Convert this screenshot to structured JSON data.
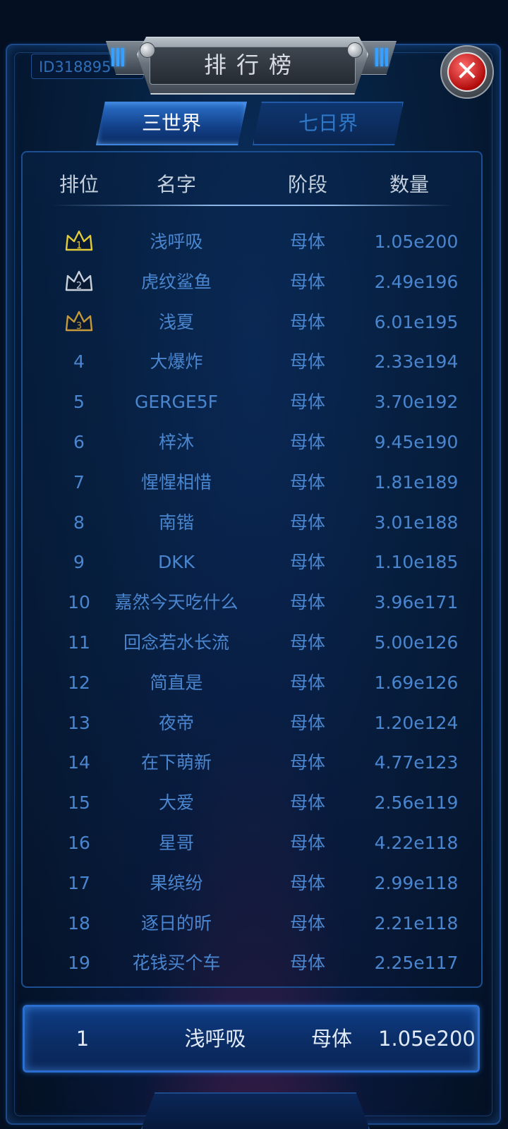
{
  "header": {
    "id_text": "ID318895",
    "title": "排行榜",
    "close_icon": "close-x-icon"
  },
  "tabs": [
    {
      "label": "三世界",
      "active": true
    },
    {
      "label": "七日界",
      "active": false
    }
  ],
  "columns": {
    "rank": "排位",
    "name": "名字",
    "stage": "阶段",
    "count": "数量"
  },
  "rows": [
    {
      "rank": "1",
      "name": "浅呼吸",
      "stage": "母体",
      "count": "1.05e200",
      "crown": "gold"
    },
    {
      "rank": "2",
      "name": "虎纹鲨鱼",
      "stage": "母体",
      "count": "2.49e196",
      "crown": "silver"
    },
    {
      "rank": "3",
      "name": "浅夏",
      "stage": "母体",
      "count": "6.01e195",
      "crown": "bronze"
    },
    {
      "rank": "4",
      "name": "大爆炸",
      "stage": "母体",
      "count": "2.33e194"
    },
    {
      "rank": "5",
      "name": "GERGE5F",
      "stage": "母体",
      "count": "3.70e192"
    },
    {
      "rank": "6",
      "name": "梓沐",
      "stage": "母体",
      "count": "9.45e190"
    },
    {
      "rank": "7",
      "name": "惺惺相惜",
      "stage": "母体",
      "count": "1.81e189"
    },
    {
      "rank": "8",
      "name": "南锴",
      "stage": "母体",
      "count": "3.01e188"
    },
    {
      "rank": "9",
      "name": "DKK",
      "stage": "母体",
      "count": "1.10e185"
    },
    {
      "rank": "10",
      "name": "嘉然今天吃什么",
      "stage": "母体",
      "count": "3.96e171"
    },
    {
      "rank": "11",
      "name": "回念若水长流",
      "stage": "母体",
      "count": "5.00e126"
    },
    {
      "rank": "12",
      "name": "简直是",
      "stage": "母体",
      "count": "1.69e126"
    },
    {
      "rank": "13",
      "name": "夜帝",
      "stage": "母体",
      "count": "1.20e124"
    },
    {
      "rank": "14",
      "name": "在下萌新",
      "stage": "母体",
      "count": "4.77e123"
    },
    {
      "rank": "15",
      "name": "大爱",
      "stage": "母体",
      "count": "2.56e119"
    },
    {
      "rank": "16",
      "name": "星哥",
      "stage": "母体",
      "count": "4.22e118"
    },
    {
      "rank": "17",
      "name": "果缤纷",
      "stage": "母体",
      "count": "2.99e118"
    },
    {
      "rank": "18",
      "name": "逐日的昕",
      "stage": "母体",
      "count": "2.21e118"
    },
    {
      "rank": "19",
      "name": "花钱买个车",
      "stage": "母体",
      "count": "2.25e117"
    }
  ],
  "my_rank": {
    "rank": "1",
    "name": "浅呼吸",
    "stage": "母体",
    "count": "1.05e200"
  },
  "colors": {
    "gold": "#e3cc3a",
    "silver": "#c9d2dc",
    "bronze": "#c49a3a"
  }
}
